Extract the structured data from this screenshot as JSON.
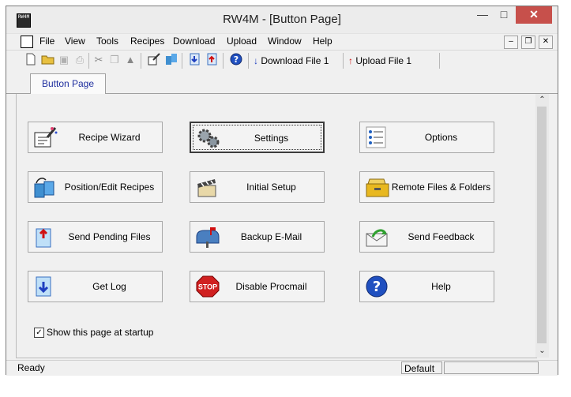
{
  "window": {
    "title": "RW4M - [Button Page]",
    "app_icon_text": "RW4M"
  },
  "menu": [
    "File",
    "View",
    "Tools",
    "Recipes",
    "Download",
    "Upload",
    "Window",
    "Help"
  ],
  "toolbar": {
    "download_label": "Download File 1",
    "upload_label": "Upload File 1"
  },
  "tabs": [
    {
      "label": "Button Page"
    }
  ],
  "buttons": [
    {
      "label": "Recipe Wizard",
      "icon": "recipe-wizard-icon"
    },
    {
      "label": "Settings",
      "icon": "gears-icon"
    },
    {
      "label": "Options",
      "icon": "list-icon"
    },
    {
      "label": "Position/Edit Recipes",
      "icon": "position-edit-icon"
    },
    {
      "label": "Initial Setup",
      "icon": "clapperboard-icon"
    },
    {
      "label": "Remote Files & Folders",
      "icon": "folder-cabinet-icon"
    },
    {
      "label": "Send Pending Files",
      "icon": "send-pending-icon"
    },
    {
      "label": "Backup E-Mail",
      "icon": "mailbox-icon"
    },
    {
      "label": "Send Feedback",
      "icon": "feedback-envelope-icon"
    },
    {
      "label": "Get Log",
      "icon": "get-log-icon"
    },
    {
      "label": "Disable Procmail",
      "icon": "stop-sign-icon"
    },
    {
      "label": "Help",
      "icon": "help-icon"
    }
  ],
  "startup_checkbox": {
    "label": "Show this page at startup",
    "checked": true
  },
  "status": {
    "left": "Ready",
    "pane": "Default"
  },
  "colors": {
    "accent_blue": "#1f3fbf",
    "accent_red": "#d01010",
    "close_red": "#c7504b"
  }
}
